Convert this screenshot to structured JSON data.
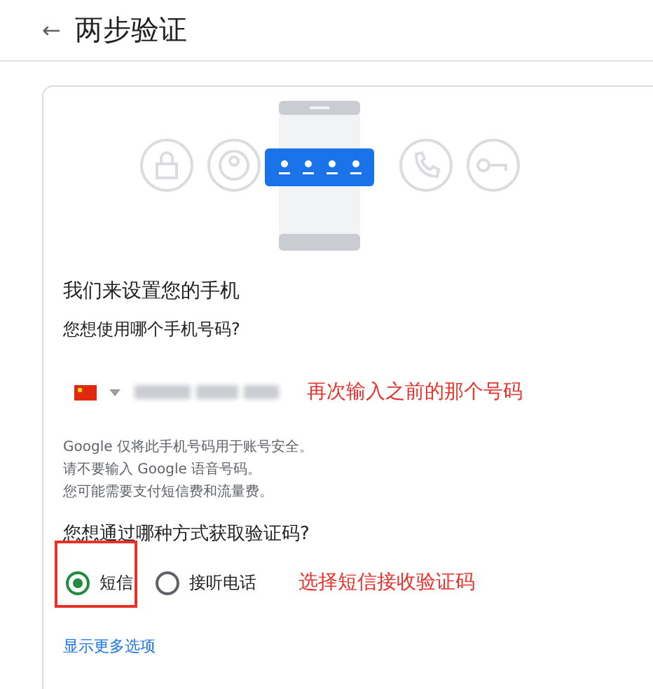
{
  "header": {
    "back_icon": "←",
    "title": "两步验证"
  },
  "card": {
    "heading": "我们来设置您的手机",
    "phone_question": "您想使用哪个手机号码?",
    "phone_annotation": "再次输入之前的那个号码",
    "notes": [
      "Google 仅将此手机号码用于账号安全。",
      "请不要输入 Google 语音号码。",
      "您可能需要支付短信费和流量费。"
    ],
    "method_question": "您想通过哪种方式获取验证码?",
    "methods": [
      {
        "label": "短信",
        "selected": true,
        "highlighted": true
      },
      {
        "label": "接听电话",
        "selected": false,
        "highlighted": false
      }
    ],
    "method_annotation": "选择短信接收验证码",
    "more_link": "显示更多选项"
  }
}
